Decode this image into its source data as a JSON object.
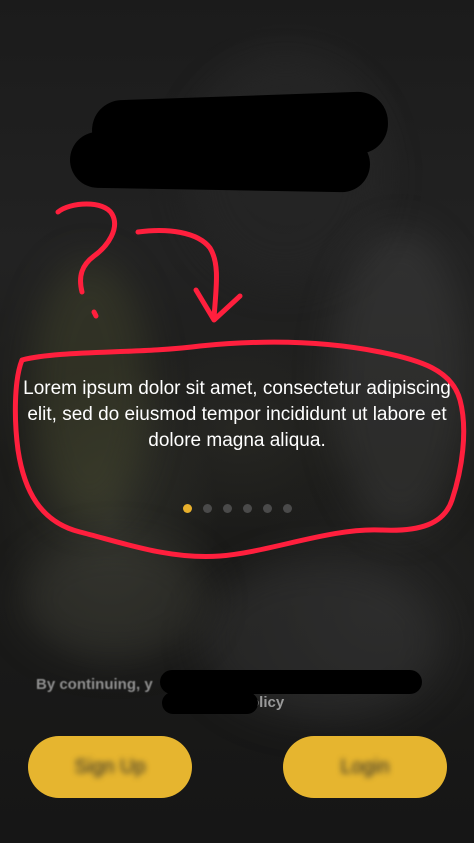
{
  "onboarding": {
    "description": "Lorem ipsum dolor sit amet, consectetur adipiscing elit, sed do eiusmod tempor incididunt ut labore et dolore magna aliqua.",
    "page_indicator": {
      "total": 6,
      "active_index": 0,
      "active_color": "#e8b02c",
      "inactive_color": "#4a4a4a"
    }
  },
  "footer": {
    "terms_prefix": "By continuing, y",
    "terms_suffix": "olicy"
  },
  "buttons": {
    "left_label": "Sign Up",
    "right_label": "Login",
    "color": "#e6b52f"
  },
  "annotation": {
    "question_mark": "?",
    "stroke_color": "#ff1f3d"
  }
}
